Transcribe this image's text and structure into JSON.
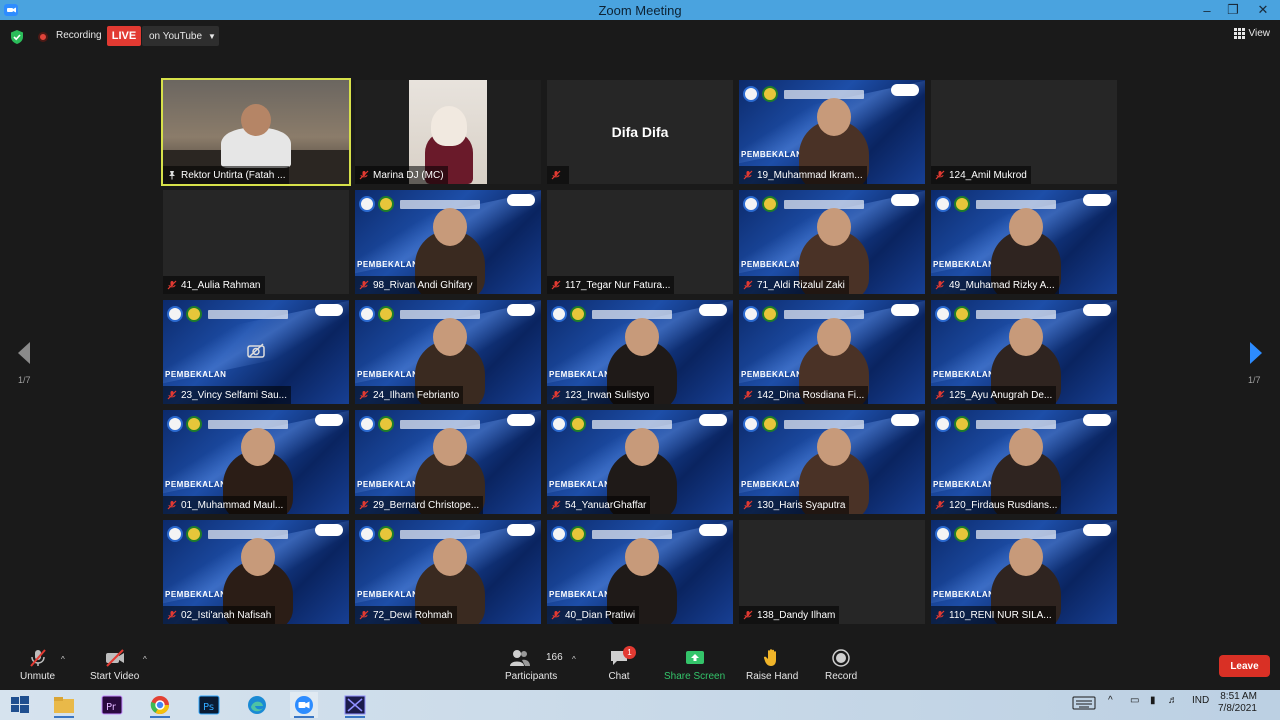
{
  "window": {
    "title": "Zoom Meeting"
  },
  "status": {
    "recording": "Recording",
    "live": "LIVE",
    "live_target": "on YouTube",
    "view": "View"
  },
  "pager": {
    "left": "1/7",
    "right": "1/7"
  },
  "tiles": [
    {
      "name": "Rektor Untirta (Fatah ...",
      "kind": "video",
      "active": true,
      "pinned": true
    },
    {
      "name": "Marina DJ (MC)",
      "kind": "video"
    },
    {
      "name": "",
      "kind": "nameonly",
      "display_name": "Difa Difa"
    },
    {
      "name": "19_Muhammad Ikram...",
      "kind": "banner"
    },
    {
      "name": "124_Amil Mukrod",
      "kind": "blank"
    },
    {
      "name": "41_Aulia Rahman",
      "kind": "blank"
    },
    {
      "name": "98_Rivan Andi Ghifary",
      "kind": "banner"
    },
    {
      "name": "117_Tegar Nur Fatura...",
      "kind": "blank"
    },
    {
      "name": "71_Aldi Rizalul Zaki",
      "kind": "banner"
    },
    {
      "name": "49_Muhamad Rizky A...",
      "kind": "banner"
    },
    {
      "name": "23_Vincy Selfami Sau...",
      "kind": "banner-camoff"
    },
    {
      "name": "24_Ilham Febrianto",
      "kind": "banner"
    },
    {
      "name": "123_Irwan Sulistyo",
      "kind": "banner"
    },
    {
      "name": "142_Dina Rosdiana Fi...",
      "kind": "banner"
    },
    {
      "name": "125_Ayu Anugrah De...",
      "kind": "banner"
    },
    {
      "name": "01_Muhammad Maul...",
      "kind": "banner"
    },
    {
      "name": "29_Bernard Christope...",
      "kind": "banner"
    },
    {
      "name": "54_YanuarGhaffar",
      "kind": "banner"
    },
    {
      "name": "130_Haris Syaputra",
      "kind": "banner"
    },
    {
      "name": "120_Firdaus Rusdians...",
      "kind": "banner"
    },
    {
      "name": "02_Isti'anah Nafisah",
      "kind": "banner"
    },
    {
      "name": "72_Dewi Rohmah",
      "kind": "banner"
    },
    {
      "name": "40_Dian Pratiwi",
      "kind": "banner"
    },
    {
      "name": "138_Dandy Ilham",
      "kind": "blank"
    },
    {
      "name": "110_RENI NUR SILA...",
      "kind": "banner"
    }
  ],
  "banner_text": "PEMBEKALAN",
  "toolbar": {
    "unmute": "Unmute",
    "start_video": "Start Video",
    "participants": "Participants",
    "participants_count": "166",
    "chat": "Chat",
    "chat_badge": "1",
    "share_screen": "Share Screen",
    "raise_hand": "Raise Hand",
    "record": "Record",
    "leave": "Leave"
  },
  "tray": {
    "lang": "IND",
    "time": "8:51 AM",
    "date": "7/8/2021"
  },
  "colors": {
    "titlebar": "#4aa3df",
    "live": "#e23a32",
    "share": "#34c46a",
    "leave": "#d93025",
    "active_tile": "#d7e14a"
  }
}
